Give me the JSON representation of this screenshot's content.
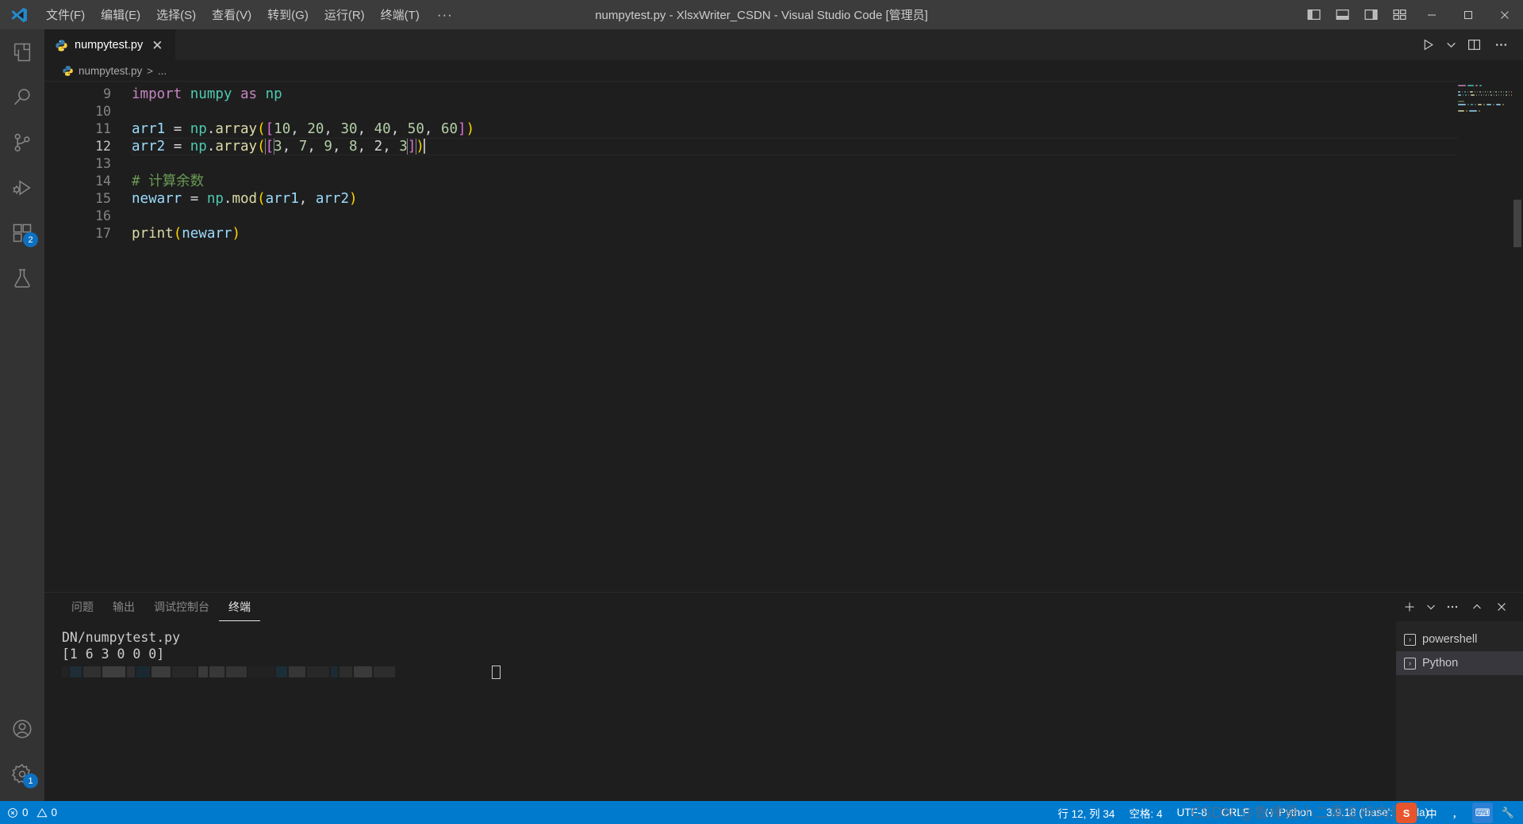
{
  "window": {
    "title": "numpytest.py - XlsxWriter_CSDN - Visual Studio Code [管理员]",
    "menu": [
      "文件(F)",
      "编辑(E)",
      "选择(S)",
      "查看(V)",
      "转到(G)",
      "运行(R)",
      "终端(T)"
    ],
    "menu_more": "···",
    "controls": {
      "minimize": "−",
      "maximize": "▢",
      "close": "✕"
    }
  },
  "activitybar": {
    "items": [
      {
        "name": "explorer",
        "badge": ""
      },
      {
        "name": "search",
        "badge": ""
      },
      {
        "name": "source-control",
        "badge": ""
      },
      {
        "name": "run-and-debug",
        "badge": ""
      },
      {
        "name": "extensions",
        "badge": "2"
      },
      {
        "name": "testing",
        "badge": ""
      },
      {
        "name": "accounts",
        "badge": ""
      },
      {
        "name": "settings",
        "badge": "1"
      }
    ]
  },
  "tabs": {
    "active": "numpytest.py",
    "close_label": "✕"
  },
  "breadcrumb": {
    "file": "numpytest.py",
    "separator": ">",
    "more": "..."
  },
  "editor": {
    "lines": [
      {
        "num": "9",
        "tokens": [
          {
            "t": "import",
            "c": "t-kw"
          },
          {
            "t": " ",
            "c": "t-op"
          },
          {
            "t": "numpy",
            "c": "t-mod"
          },
          {
            "t": " ",
            "c": "t-op"
          },
          {
            "t": "as",
            "c": "t-kw"
          },
          {
            "t": " ",
            "c": "t-op"
          },
          {
            "t": "np",
            "c": "t-mod"
          }
        ]
      },
      {
        "num": "10",
        "tokens": []
      },
      {
        "num": "11",
        "tokens": [
          {
            "t": "arr1",
            "c": "t-var"
          },
          {
            "t": " = ",
            "c": "t-op"
          },
          {
            "t": "np",
            "c": "t-mod"
          },
          {
            "t": ".",
            "c": "t-op"
          },
          {
            "t": "array",
            "c": "t-fn"
          },
          {
            "t": "(",
            "c": "t-p1"
          },
          {
            "t": "[",
            "c": "t-p2"
          },
          {
            "t": "10",
            "c": "t-num"
          },
          {
            "t": ", ",
            "c": "t-op"
          },
          {
            "t": "20",
            "c": "t-num"
          },
          {
            "t": ", ",
            "c": "t-op"
          },
          {
            "t": "30",
            "c": "t-num"
          },
          {
            "t": ", ",
            "c": "t-op"
          },
          {
            "t": "40",
            "c": "t-num"
          },
          {
            "t": ", ",
            "c": "t-op"
          },
          {
            "t": "50",
            "c": "t-num"
          },
          {
            "t": ", ",
            "c": "t-op"
          },
          {
            "t": "60",
            "c": "t-num"
          },
          {
            "t": "]",
            "c": "t-p2"
          },
          {
            "t": ")",
            "c": "t-p1"
          }
        ]
      },
      {
        "num": "12",
        "current": true,
        "tokens": [
          {
            "t": "arr2",
            "c": "t-var"
          },
          {
            "t": " = ",
            "c": "t-op"
          },
          {
            "t": "np",
            "c": "t-mod"
          },
          {
            "t": ".",
            "c": "t-op"
          },
          {
            "t": "array",
            "c": "t-fn"
          },
          {
            "t": "(",
            "c": "t-p1"
          },
          {
            "t": "[",
            "c": "t-p2 bracket-match"
          },
          {
            "t": "3",
            "c": "t-num"
          },
          {
            "t": ", ",
            "c": "t-op"
          },
          {
            "t": "7",
            "c": "t-num"
          },
          {
            "t": ", ",
            "c": "t-op"
          },
          {
            "t": "9",
            "c": "t-num"
          },
          {
            "t": ", ",
            "c": "t-op"
          },
          {
            "t": "8",
            "c": "t-num"
          },
          {
            "t": ", ",
            "c": "t-op"
          },
          {
            "t": "2",
            "c": "t-op"
          },
          {
            "t": ", ",
            "c": "t-op"
          },
          {
            "t": "3",
            "c": "t-num"
          },
          {
            "t": "]",
            "c": "t-p2 bracket-match"
          },
          {
            "t": ")",
            "c": "t-p1"
          }
        ]
      },
      {
        "num": "13",
        "tokens": []
      },
      {
        "num": "14",
        "tokens": [
          {
            "t": "# 计算余数",
            "c": "t-comment"
          }
        ]
      },
      {
        "num": "15",
        "tokens": [
          {
            "t": "newarr",
            "c": "t-var"
          },
          {
            "t": " = ",
            "c": "t-op"
          },
          {
            "t": "np",
            "c": "t-mod"
          },
          {
            "t": ".",
            "c": "t-op"
          },
          {
            "t": "mod",
            "c": "t-fn"
          },
          {
            "t": "(",
            "c": "t-p1"
          },
          {
            "t": "arr1",
            "c": "t-var"
          },
          {
            "t": ", ",
            "c": "t-op"
          },
          {
            "t": "arr2",
            "c": "t-var"
          },
          {
            "t": ")",
            "c": "t-p1"
          }
        ]
      },
      {
        "num": "16",
        "tokens": []
      },
      {
        "num": "17",
        "tokens": [
          {
            "t": "print",
            "c": "t-fn"
          },
          {
            "t": "(",
            "c": "t-p1"
          },
          {
            "t": "newarr",
            "c": "t-var"
          },
          {
            "t": ")",
            "c": "t-p1"
          }
        ]
      }
    ]
  },
  "panel": {
    "tabs": [
      {
        "label": "问题",
        "active": false
      },
      {
        "label": "输出",
        "active": false
      },
      {
        "label": "调试控制台",
        "active": false
      },
      {
        "label": "终端",
        "active": true
      }
    ],
    "terminal_output": [
      "DN/numpytest.py",
      "[1 6 3 0 0 0]"
    ],
    "terminal_list": [
      {
        "label": "powershell",
        "active": false
      },
      {
        "label": "Python",
        "active": true
      }
    ]
  },
  "statusbar": {
    "errors": "0",
    "warnings": "0",
    "cursor_position": "行 12, 列 34",
    "indent": "空格: 4",
    "encoding": "UTF-8",
    "eol": "CRLF",
    "language": "Python",
    "watermark": "CSDN @鲁棒最小二乘支持向量机",
    "version_overlay": "3.9.18 ('base': conda)",
    "ime": {
      "mode": "中",
      "punct": "，"
    }
  },
  "colors": {
    "accent": "#007acc",
    "titlebar": "#3c3c3c",
    "activitybar": "#333333",
    "editor_bg": "#1e1e1e",
    "tab_bg": "#252526",
    "badge": "#0e70c0"
  }
}
